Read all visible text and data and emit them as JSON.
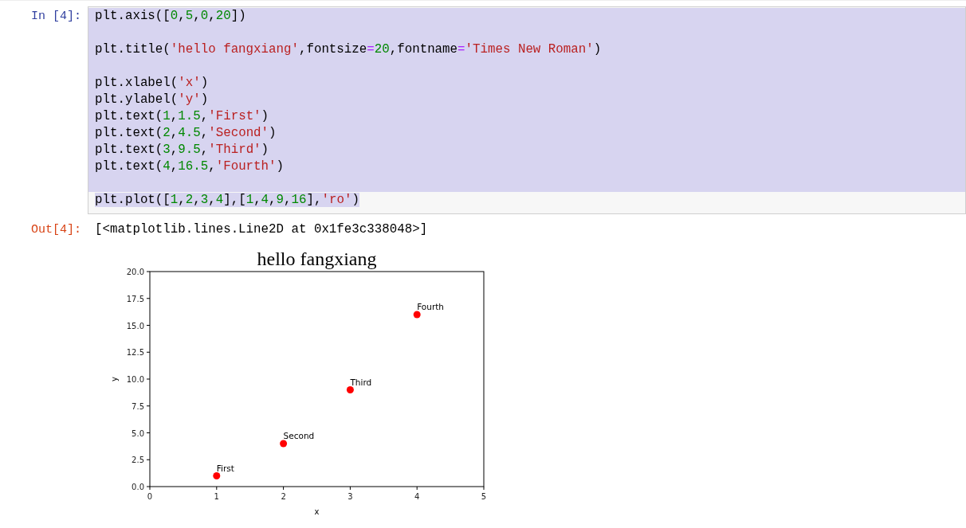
{
  "input_cell": {
    "prompt": "In  [4]:",
    "lines": [
      {
        "kind": "code",
        "selected": true,
        "tokens": [
          {
            "kind": "plain",
            "text": "plt.axis(["
          },
          {
            "kind": "number",
            "text": "0"
          },
          {
            "kind": "plain",
            "text": ","
          },
          {
            "kind": "number",
            "text": "5"
          },
          {
            "kind": "plain",
            "text": ","
          },
          {
            "kind": "number",
            "text": "0"
          },
          {
            "kind": "plain",
            "text": ","
          },
          {
            "kind": "number",
            "text": "20"
          },
          {
            "kind": "plain",
            "text": "])"
          }
        ]
      },
      {
        "kind": "blank",
        "selected": true
      },
      {
        "kind": "code",
        "selected": true,
        "tokens": [
          {
            "kind": "plain",
            "text": "plt.title("
          },
          {
            "kind": "string",
            "text": "'hello fangxiang'"
          },
          {
            "kind": "plain",
            "text": ",fontsize"
          },
          {
            "kind": "operator",
            "text": "="
          },
          {
            "kind": "number",
            "text": "20"
          },
          {
            "kind": "plain",
            "text": ",fontname"
          },
          {
            "kind": "operator",
            "text": "="
          },
          {
            "kind": "string",
            "text": "'Times New Roman'"
          },
          {
            "kind": "plain",
            "text": ")"
          }
        ]
      },
      {
        "kind": "blank",
        "selected": true
      },
      {
        "kind": "code",
        "selected": true,
        "tokens": [
          {
            "kind": "plain",
            "text": "plt.xlabel("
          },
          {
            "kind": "string",
            "text": "'x'"
          },
          {
            "kind": "plain",
            "text": ")"
          }
        ]
      },
      {
        "kind": "code",
        "selected": true,
        "tokens": [
          {
            "kind": "plain",
            "text": "plt.ylabel("
          },
          {
            "kind": "string",
            "text": "'y'"
          },
          {
            "kind": "plain",
            "text": ")"
          }
        ]
      },
      {
        "kind": "code",
        "selected": true,
        "tokens": [
          {
            "kind": "plain",
            "text": "plt.text("
          },
          {
            "kind": "number",
            "text": "1"
          },
          {
            "kind": "plain",
            "text": ","
          },
          {
            "kind": "number",
            "text": "1.5"
          },
          {
            "kind": "plain",
            "text": ","
          },
          {
            "kind": "string",
            "text": "'First'"
          },
          {
            "kind": "plain",
            "text": ")"
          }
        ]
      },
      {
        "kind": "code",
        "selected": true,
        "tokens": [
          {
            "kind": "plain",
            "text": "plt.text("
          },
          {
            "kind": "number",
            "text": "2"
          },
          {
            "kind": "plain",
            "text": ","
          },
          {
            "kind": "number",
            "text": "4.5"
          },
          {
            "kind": "plain",
            "text": ","
          },
          {
            "kind": "string",
            "text": "'Second'"
          },
          {
            "kind": "plain",
            "text": ")"
          }
        ]
      },
      {
        "kind": "code",
        "selected": true,
        "tokens": [
          {
            "kind": "plain",
            "text": "plt.text("
          },
          {
            "kind": "number",
            "text": "3"
          },
          {
            "kind": "plain",
            "text": ","
          },
          {
            "kind": "number",
            "text": "9.5"
          },
          {
            "kind": "plain",
            "text": ","
          },
          {
            "kind": "string",
            "text": "'Third'"
          },
          {
            "kind": "plain",
            "text": ")"
          }
        ]
      },
      {
        "kind": "code",
        "selected": true,
        "tokens": [
          {
            "kind": "plain",
            "text": "plt.text("
          },
          {
            "kind": "number",
            "text": "4"
          },
          {
            "kind": "plain",
            "text": ","
          },
          {
            "kind": "number",
            "text": "16.5"
          },
          {
            "kind": "plain",
            "text": ","
          },
          {
            "kind": "string",
            "text": "'Fourth'"
          },
          {
            "kind": "plain",
            "text": ")"
          }
        ]
      },
      {
        "kind": "blank",
        "selected": true
      },
      {
        "kind": "code",
        "selected": true,
        "tokens": [
          {
            "kind": "plain",
            "text": "plt.plot(["
          },
          {
            "kind": "number",
            "text": "1"
          },
          {
            "kind": "plain",
            "text": ","
          },
          {
            "kind": "number",
            "text": "2"
          },
          {
            "kind": "plain",
            "text": ","
          },
          {
            "kind": "number",
            "text": "3"
          },
          {
            "kind": "plain",
            "text": ","
          },
          {
            "kind": "number",
            "text": "4"
          },
          {
            "kind": "plain",
            "text": "],["
          },
          {
            "kind": "number",
            "text": "1"
          },
          {
            "kind": "plain",
            "text": ","
          },
          {
            "kind": "number",
            "text": "4"
          },
          {
            "kind": "plain",
            "text": ","
          },
          {
            "kind": "number",
            "text": "9"
          },
          {
            "kind": "plain",
            "text": ","
          },
          {
            "kind": "number",
            "text": "16"
          },
          {
            "kind": "plain",
            "text": "],"
          },
          {
            "kind": "string",
            "text": "'ro'"
          },
          {
            "kind": "plain",
            "text": ")"
          }
        ]
      }
    ]
  },
  "output_cell": {
    "prompt": "Out[4]:",
    "text": "[<matplotlib.lines.Line2D at 0x1fe3c338048>]",
    "chart_data": {
      "type": "scatter",
      "title": "hello fangxiang",
      "xlabel": "x",
      "ylabel": "y",
      "x": [
        1,
        2,
        3,
        4
      ],
      "series": [
        {
          "color": "#ff0000",
          "values": [
            1,
            4,
            9,
            16
          ]
        }
      ],
      "xlim": [
        0,
        5
      ],
      "ylim": [
        0,
        20
      ],
      "xticks": [
        {
          "value": 0,
          "label": "0"
        },
        {
          "value": 1,
          "label": "1"
        },
        {
          "value": 2,
          "label": "2"
        },
        {
          "value": 3,
          "label": "3"
        },
        {
          "value": 4,
          "label": "4"
        },
        {
          "value": 5,
          "label": "5"
        }
      ],
      "yticks": [
        {
          "value": 0,
          "label": "0.0"
        },
        {
          "value": 2.5,
          "label": "2.5"
        },
        {
          "value": 5,
          "label": "5.0"
        },
        {
          "value": 7.5,
          "label": "7.5"
        },
        {
          "value": 10,
          "label": "10.0"
        },
        {
          "value": 12.5,
          "label": "12.5"
        },
        {
          "value": 15,
          "label": "15.0"
        },
        {
          "value": 17.5,
          "label": "17.5"
        },
        {
          "value": 20,
          "label": "20.0"
        }
      ],
      "annotations": [
        {
          "x": 1,
          "y": 1.5,
          "text": "First"
        },
        {
          "x": 2,
          "y": 4.5,
          "text": "Second"
        },
        {
          "x": 3,
          "y": 9.5,
          "text": "Third"
        },
        {
          "x": 4,
          "y": 16.5,
          "text": "Fourth"
        }
      ]
    }
  }
}
